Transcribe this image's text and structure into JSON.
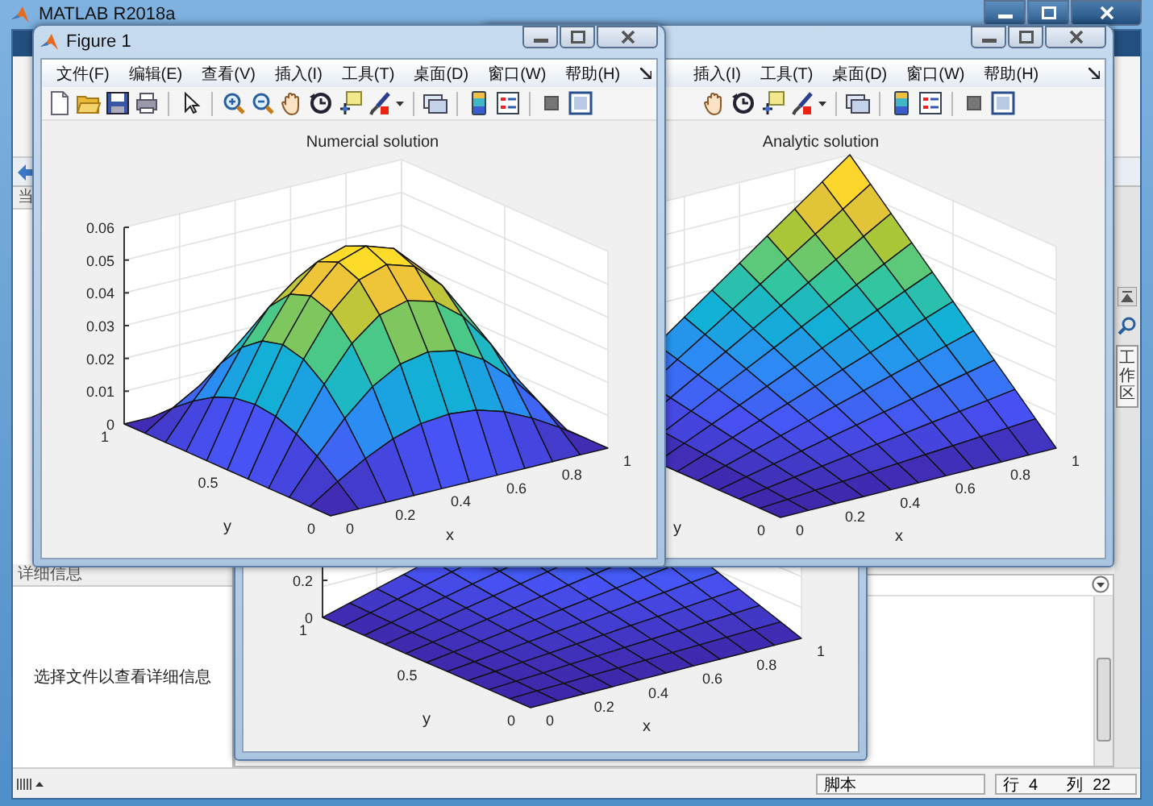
{
  "main_window": {
    "title": "MATLAB R2018a",
    "folder_panel": {
      "header": "当"
    },
    "details_panel": {
      "header": "详细信息",
      "message": "选择文件以查看详细信息"
    },
    "workspace_tab": "工作区",
    "status_bar": {
      "mode": "脚本",
      "row_label": "行",
      "row": "4",
      "col_label": "列",
      "col": "22"
    }
  },
  "figures": [
    {
      "title": "Figure 1",
      "menu": [
        "文件(F)",
        "编辑(E)",
        "查看(V)",
        "插入(I)",
        "工具(T)",
        "桌面(D)",
        "窗口(W)",
        "帮助(H)"
      ],
      "plot": {
        "kind": "bump",
        "title": "Numercial solution",
        "z_ticks": [
          "0.06",
          "0.05",
          "0.04",
          "0.03",
          "0.02",
          "0.01",
          "0"
        ],
        "y_ticks": [
          "1",
          "0.5",
          "0"
        ],
        "x_ticks": [
          "0",
          "0.2",
          "0.4",
          "0.6",
          "0.8",
          "1"
        ],
        "xlabel": "x",
        "ylabel": "y"
      }
    },
    {
      "covered_left": true,
      "menu": [
        "插入(I)",
        "工具(T)",
        "桌面(D)",
        "窗口(W)",
        "帮助(H)"
      ],
      "plot": {
        "kind": "ramp",
        "title": "Analytic solution",
        "y_ticks": [
          "0"
        ],
        "x_ticks": [
          "0",
          "0.2",
          "0.4",
          "0.6",
          "0.8",
          "1"
        ],
        "xlabel": "x",
        "ylabel": "y"
      }
    },
    {
      "plot": {
        "kind": "low-ramp",
        "z_ticks": [
          "0.2",
          "0"
        ],
        "y_ticks": [
          "1",
          "0.5",
          "0"
        ],
        "x_ticks": [
          "0",
          "0.2",
          "0.4",
          "0.6",
          "0.8",
          "1"
        ],
        "xlabel": "x",
        "ylabel": "y"
      }
    }
  ]
}
